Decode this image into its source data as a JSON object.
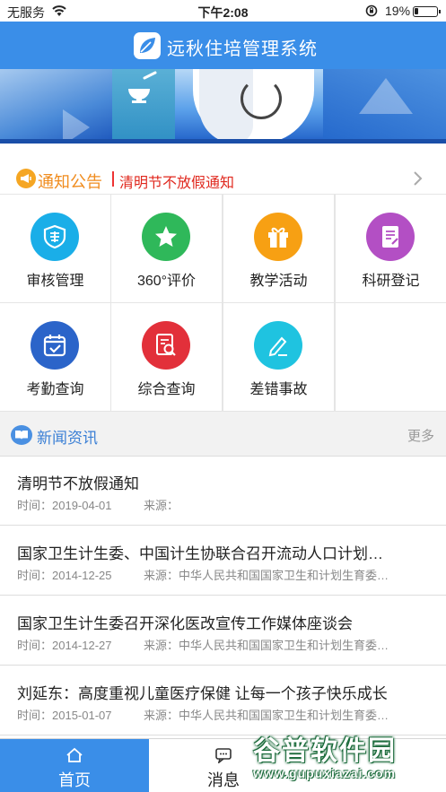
{
  "status_bar": {
    "carrier": "无服务",
    "time": "下午2:08",
    "battery_percent": "19%",
    "battery_level": 0.19
  },
  "header": {
    "title": "远秋住培管理系统",
    "logo_icon": "leaf-logo-icon"
  },
  "notice": {
    "label": "通知公告",
    "text": "清明节不放假通知",
    "icon": "megaphone-icon"
  },
  "grid": {
    "items": [
      {
        "label": "审核管理",
        "icon": "shield-audit-icon",
        "color": "#1aaee8"
      },
      {
        "label": "360°评价",
        "icon": "star-icon",
        "color": "#2fb85a"
      },
      {
        "label": "教学活动",
        "icon": "gift-icon",
        "color": "#f7a013"
      },
      {
        "label": "科研登记",
        "icon": "document-edit-icon",
        "color": "#b34fc4"
      },
      {
        "label": "考勤查询",
        "icon": "calendar-check-icon",
        "color": "#2b64c9"
      },
      {
        "label": "综合查询",
        "icon": "report-search-icon",
        "color": "#e2303a"
      },
      {
        "label": "差错事故",
        "icon": "pencil-icon",
        "color": "#1fc3e0"
      }
    ]
  },
  "news": {
    "title": "新闻资讯",
    "more": "更多",
    "items": [
      {
        "headline": "清明节不放假通知",
        "time": "时间：2019-04-01",
        "source": "来源："
      },
      {
        "headline": "国家卫生计生委、中国计生协联合召开流动人口计划生育",
        "time": "时间：2014-12-25",
        "source": "来源：中华人民共和国国家卫生和计划生育委员会"
      },
      {
        "headline": "国家卫生计生委召开深化医改宣传工作媒体座谈会",
        "time": "时间：2014-12-27",
        "source": "来源：中华人民共和国国家卫生和计划生育委员会"
      },
      {
        "headline": "刘延东：高度重视儿童医疗保健 让每一个孩子快乐成长",
        "time": "时间：2015-01-07",
        "source": "来源：中华人民共和国国家卫生和计划生育委员会"
      }
    ]
  },
  "tabs": {
    "home": "首页",
    "messages": "消息"
  },
  "watermark": {
    "text": "谷普软件园",
    "url": "www.gupuxiazai.com"
  },
  "colors": {
    "primary": "#3a8ee8",
    "notice_label": "#f08c1e",
    "notice_text": "#e0281e"
  }
}
